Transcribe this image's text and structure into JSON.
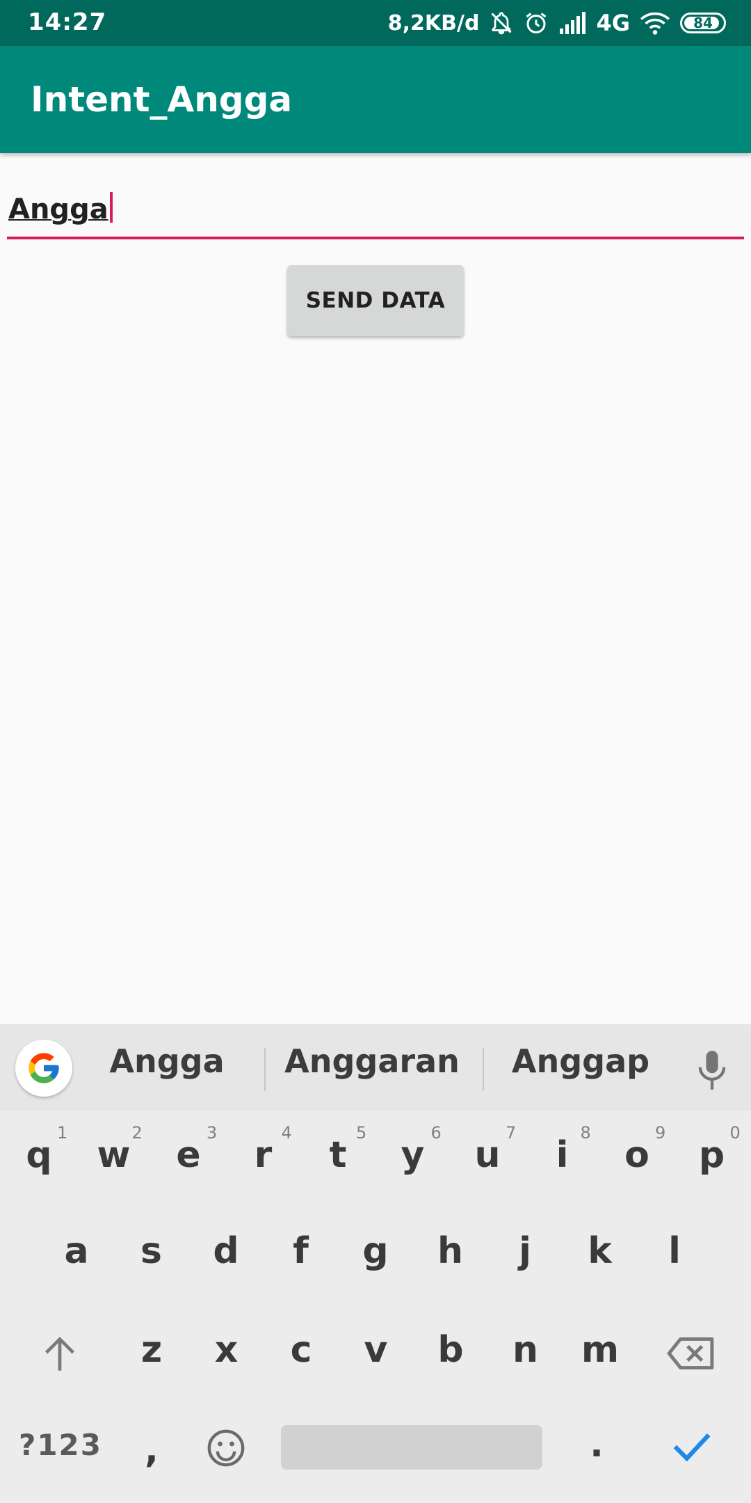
{
  "status_bar": {
    "time": "14:27",
    "net_speed": "8,2KB/d",
    "network_type": "4G",
    "battery_level": "84",
    "icons": [
      "bell-off-icon",
      "alarm-icon",
      "signal-icon",
      "wifi-icon",
      "battery-icon"
    ]
  },
  "app_bar": {
    "title": "Intent_Angga",
    "color": "#00897b"
  },
  "form": {
    "input_value": "Angga",
    "underline_color": "#d81b60",
    "button_label": "SEND DATA"
  },
  "keyboard": {
    "suggestions": [
      "Angga",
      "Anggaran",
      "Anggap"
    ],
    "row1": [
      "q",
      "w",
      "e",
      "r",
      "t",
      "y",
      "u",
      "i",
      "o",
      "p"
    ],
    "row1_hints": [
      "1",
      "2",
      "3",
      "4",
      "5",
      "6",
      "7",
      "8",
      "9",
      "0"
    ],
    "row2": [
      "a",
      "s",
      "d",
      "f",
      "g",
      "h",
      "j",
      "k",
      "l"
    ],
    "row3": [
      "z",
      "x",
      "c",
      "v",
      "b",
      "n",
      "m"
    ],
    "symbols_key": "?123",
    "comma_key": ",",
    "period_key": ".",
    "icons": [
      "google-icon",
      "mic-icon",
      "shift-icon",
      "backspace-icon",
      "emoji-icon",
      "checkmark-icon"
    ],
    "accent_color": "#1e88e5"
  }
}
